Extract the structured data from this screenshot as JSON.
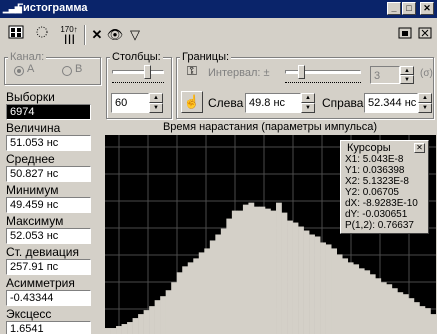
{
  "window": {
    "title": "Гистограмма",
    "app_icon": "histogram-icon"
  },
  "toolbar": {
    "scale_label": "170↑"
  },
  "channel": {
    "group_label": "Канал:",
    "options": [
      "A",
      "B"
    ],
    "selected": "A"
  },
  "columns": {
    "group_label": "Столбцы:",
    "value": "60"
  },
  "bounds": {
    "group_label": "Границы:",
    "interval_label": "Интервал: ±",
    "interval_value": "3",
    "interval_unit": "(σ)",
    "left_label": "Слева",
    "left_value": "49.8 нс",
    "right_label": "Справа",
    "right_value": "52.344 нс"
  },
  "stats": [
    {
      "label": "Выборки",
      "value": "6974",
      "selected": true
    },
    {
      "label": "Величина",
      "value": "51.053 нс"
    },
    {
      "label": "Среднее",
      "value": "50.827 нс"
    },
    {
      "label": "Минимум",
      "value": "49.459 нс"
    },
    {
      "label": "Максимум",
      "value": "52.053 нс"
    },
    {
      "label": "Ст. девиация",
      "value": "257.91 пс"
    },
    {
      "label": "Асимметрия",
      "value": "-0.43344"
    },
    {
      "label": "Эксцесс",
      "value": "1.6541"
    }
  ],
  "chart_data": {
    "type": "bar",
    "title": "Время нарастания (параметры импульса)",
    "grid": true,
    "ylim": [
      0,
      1
    ],
    "values": [
      0.03,
      0.03,
      0.04,
      0.05,
      0.06,
      0.08,
      0.1,
      0.12,
      0.14,
      0.17,
      0.19,
      0.22,
      0.26,
      0.31,
      0.34,
      0.36,
      0.38,
      0.41,
      0.43,
      0.47,
      0.5,
      0.53,
      0.58,
      0.62,
      0.62,
      0.65,
      0.66,
      0.64,
      0.64,
      0.63,
      0.62,
      0.66,
      0.61,
      0.57,
      0.56,
      0.54,
      0.52,
      0.5,
      0.49,
      0.46,
      0.45,
      0.43,
      0.4,
      0.38,
      0.36,
      0.35,
      0.33,
      0.32,
      0.3,
      0.28,
      0.26,
      0.25,
      0.23,
      0.21,
      0.2,
      0.18,
      0.16,
      0.14,
      0.13,
      0.1
    ]
  },
  "cursors": {
    "title": "Курсоры",
    "lines": [
      "X1: 5.043E-8",
      "Y1: 0.036398",
      "X2: 5.1323E-8",
      "Y2: 0.06705",
      "dX: -8.9283E-10",
      "dY: -0.030651",
      "P(1,2): 0.76637"
    ]
  }
}
